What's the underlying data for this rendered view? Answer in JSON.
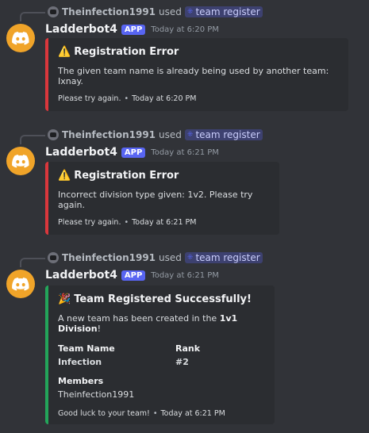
{
  "messages": [
    {
      "reply_user": "Theinfection1991",
      "reply_used": "used",
      "reply_command": "team register",
      "author": "Ladderbot4",
      "tag": "APP",
      "time": "Today at 6:20 PM",
      "embed": {
        "color": "#da373c",
        "title": "Registration Error",
        "description": "The given team name is already being used by another team: Ixnay.",
        "footer": "Please try again.",
        "footer_time": "Today at 6:20 PM"
      }
    },
    {
      "reply_user": "Theinfection1991",
      "reply_used": "used",
      "reply_command": "team register",
      "author": "Ladderbot4",
      "tag": "APP",
      "time": "Today at 6:21 PM",
      "embed": {
        "color": "#da373c",
        "title": "Registration Error",
        "description": "Incorrect division type given: 1v2. Please try again.",
        "footer": "Please try again.",
        "footer_time": "Today at 6:21 PM"
      }
    },
    {
      "reply_user": "Theinfection1991",
      "reply_used": "used",
      "reply_command": "team register",
      "author": "Ladderbot4",
      "tag": "APP",
      "time": "Today at 6:21 PM",
      "embed": {
        "color": "#23a55a",
        "title": "Team Registered Successfully!",
        "description_prefix": "A new team has been created in the ",
        "description_bold": "1v1 Division",
        "description_suffix": "!",
        "fields": {
          "team_name_label": "Team Name",
          "team_name_value": "Infection",
          "rank_label": "Rank",
          "rank_value": "#2",
          "members_label": "Members",
          "members_value": "Theinfection1991"
        },
        "footer": "Good luck to your team!",
        "footer_time": "Today at 6:21 PM"
      }
    }
  ],
  "icons": {
    "warning": "warning-icon",
    "party": "party-popper-icon",
    "discord": "discord-logo-icon",
    "command": "slash-command-icon"
  },
  "colors": {
    "background": "#313338",
    "embed_bg": "#2b2d31",
    "error": "#da373c",
    "success": "#23a55a",
    "brand": "#5865f2",
    "avatar": "#f0a429"
  }
}
